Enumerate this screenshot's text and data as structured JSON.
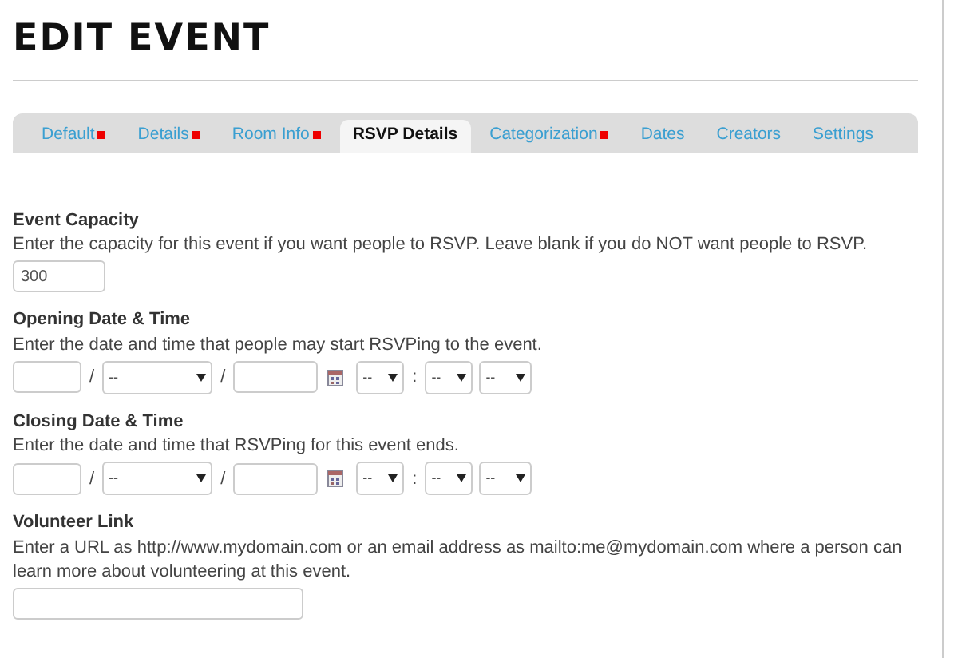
{
  "page_title": "EDIT EVENT",
  "tabs": [
    {
      "label": "Default",
      "selected": false,
      "required": true
    },
    {
      "label": "Details",
      "selected": false,
      "required": true
    },
    {
      "label": "Room Info",
      "selected": false,
      "required": true
    },
    {
      "label": "RSVP Details",
      "selected": true,
      "required": false
    },
    {
      "label": "Categorization",
      "selected": false,
      "required": true
    },
    {
      "label": "Dates",
      "selected": false,
      "required": false
    },
    {
      "label": "Creators",
      "selected": false,
      "required": false
    },
    {
      "label": "Settings",
      "selected": false,
      "required": false
    }
  ],
  "fields": [
    {
      "kind": "number",
      "label": "Event Capacity",
      "help": "Enter the capacity for this event if you want people to RSVP. Leave blank if you do NOT want people to RSVP.",
      "value": "300"
    },
    {
      "kind": "datetime",
      "label": "Opening Date & Time",
      "help": "Enter the date and time that people may start RSVPing to the event.",
      "month": "--",
      "hour": "--",
      "minute": "--",
      "ampm": "--",
      "date_sep": "/",
      "time_sep": ":"
    },
    {
      "kind": "datetime",
      "label": "Closing Date & Time",
      "help": "Enter the date and time that RSVPing for this event ends.",
      "month": "--",
      "hour": "--",
      "minute": "--",
      "ampm": "--",
      "date_sep": "/",
      "time_sep": ":"
    },
    {
      "kind": "url",
      "label": "Volunteer Link",
      "help": "Enter a URL as http://www.mydomain.com or an email address as mailto:me@mydomain.com where a person can learn more about volunteering at this event."
    }
  ]
}
